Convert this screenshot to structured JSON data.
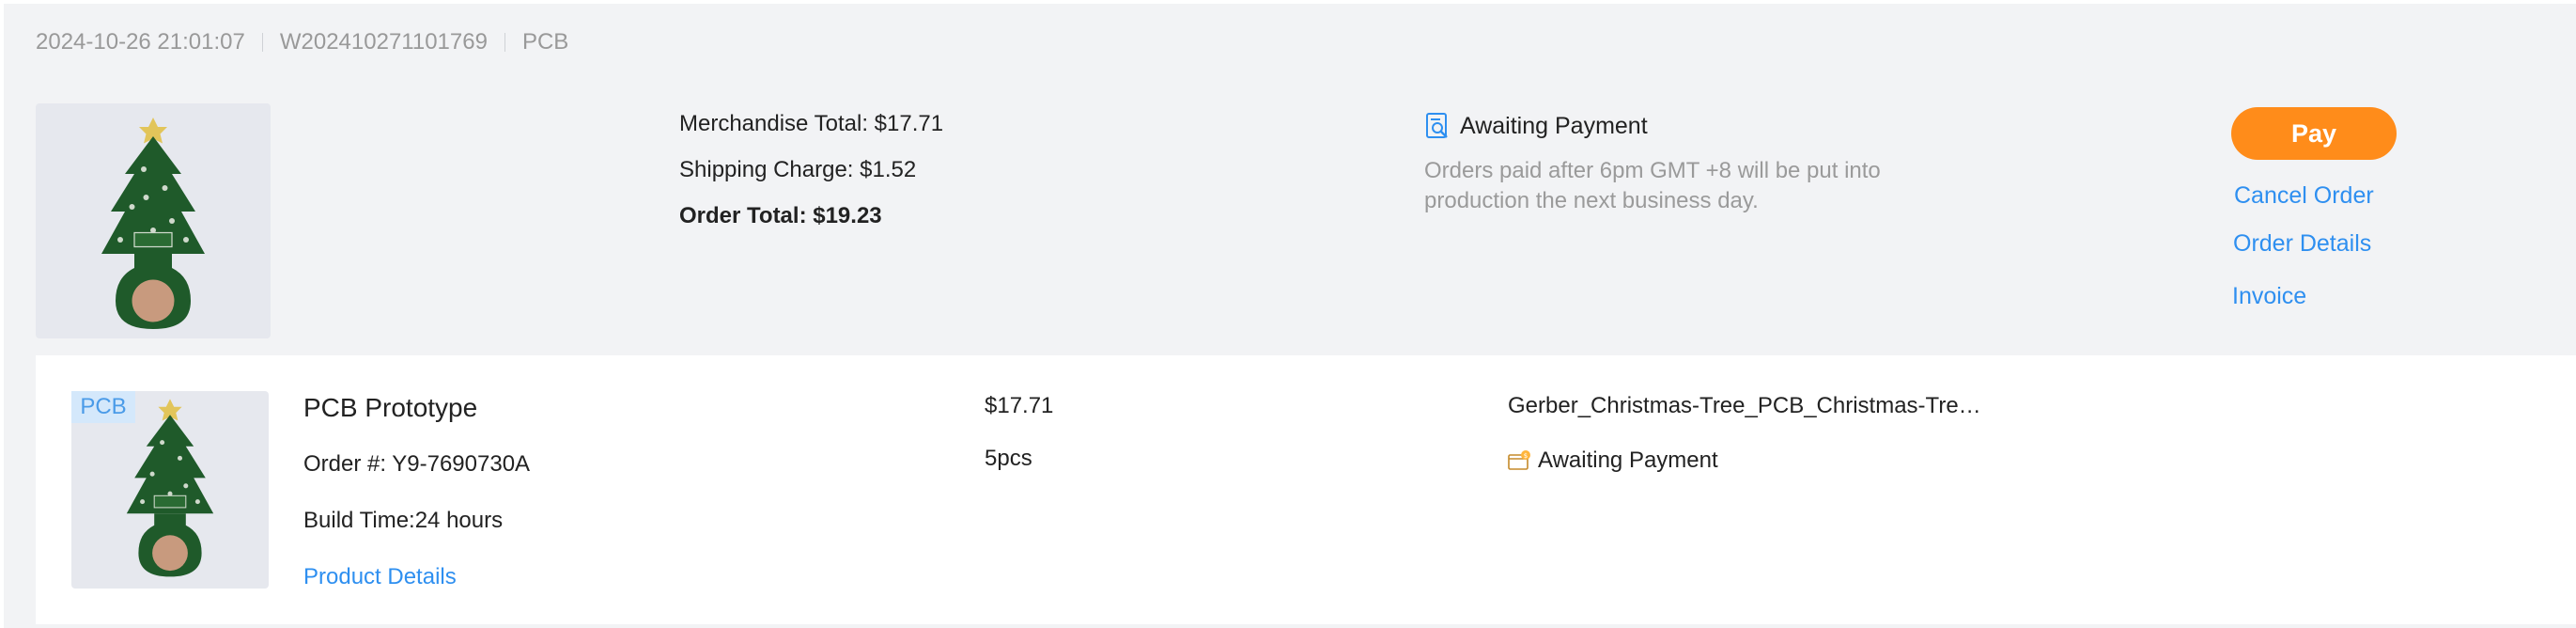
{
  "order": {
    "datetime": "2024-10-26 21:01:07",
    "order_id": "W202410271101769",
    "category": "PCB"
  },
  "summary": {
    "merchandise_total": "Merchandise Total: $17.71",
    "shipping_charge": "Shipping Charge: $1.52",
    "order_total": "Order Total: $19.23"
  },
  "status": {
    "label": "Awaiting Payment",
    "note": "Orders paid after 6pm GMT +8 will be put into production the next business day.",
    "icon": "document-search-icon"
  },
  "actions": {
    "pay": "Pay",
    "cancel": "Cancel Order",
    "details": "Order Details",
    "invoice": "Invoice"
  },
  "item": {
    "badge": "PCB",
    "title": "PCB Prototype",
    "order_no": "Order #: Y9-7690730A",
    "build_time": "Build Time:24 hours",
    "details_link": "Product Details",
    "price": "$17.71",
    "quantity": "5pcs",
    "file": "Gerber_Christmas-Tree_PCB_Christmas-Tre…",
    "status": "Awaiting Payment",
    "status_icon": "package-icon"
  },
  "colors": {
    "accent": "#ff8c1a",
    "link": "#2e8ff0",
    "muted": "#999999",
    "pcb_green": "#1f5a2a"
  }
}
